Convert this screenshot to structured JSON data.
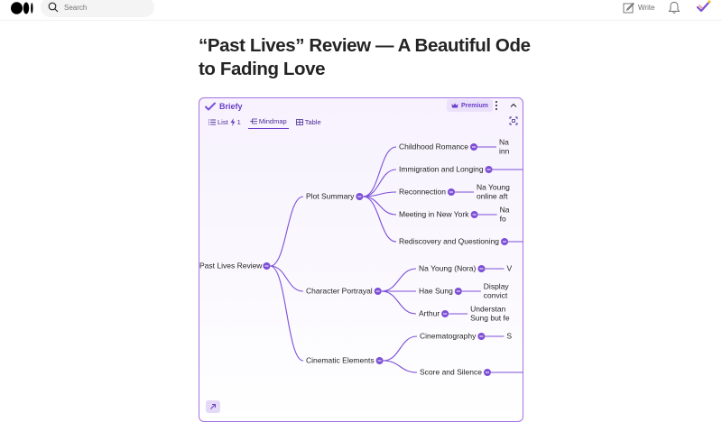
{
  "header": {
    "search_placeholder": "Search",
    "write_label": "Write"
  },
  "article": {
    "title": "“Past Lives” Review — A Beautiful Ode to Fading Love"
  },
  "briefy": {
    "brand": "Briefy",
    "premium_label": "Premium",
    "tabs": [
      {
        "label": "List",
        "badge": "1"
      },
      {
        "label": "Mindmap"
      },
      {
        "label": "Table"
      }
    ],
    "active_tab": "Mindmap"
  },
  "mindmap": {
    "root": "Past Lives Review",
    "branches": [
      {
        "label": "Plot Summary",
        "children": [
          {
            "label": "Childhood Romance",
            "detail": [
              "Na",
              "inn"
            ]
          },
          {
            "label": "Immigration and Longing",
            "detail": []
          },
          {
            "label": "Reconnection",
            "detail": [
              "Na Young",
              "online aft"
            ]
          },
          {
            "label": "Meeting in New York",
            "detail": [
              "Na",
              "fo"
            ]
          },
          {
            "label": "Rediscovery and Questioning",
            "detail": []
          }
        ]
      },
      {
        "label": "Character Portrayal",
        "children": [
          {
            "label": "Na Young (Nora)",
            "detail": [
              "V"
            ]
          },
          {
            "label": "Hae Sung",
            "detail": [
              "Display",
              "convict"
            ]
          },
          {
            "label": "Arthur",
            "detail": [
              "Understan",
              "Sung but fe"
            ]
          }
        ]
      },
      {
        "label": "Cinematic Elements",
        "children": [
          {
            "label": "Cinematography",
            "detail": [
              "S"
            ]
          },
          {
            "label": "Score and Silence",
            "detail": []
          }
        ]
      }
    ]
  },
  "colors": {
    "accent": "#6a3fc8",
    "edge": "#7c4fd6",
    "panel_border": "#a374e0"
  }
}
